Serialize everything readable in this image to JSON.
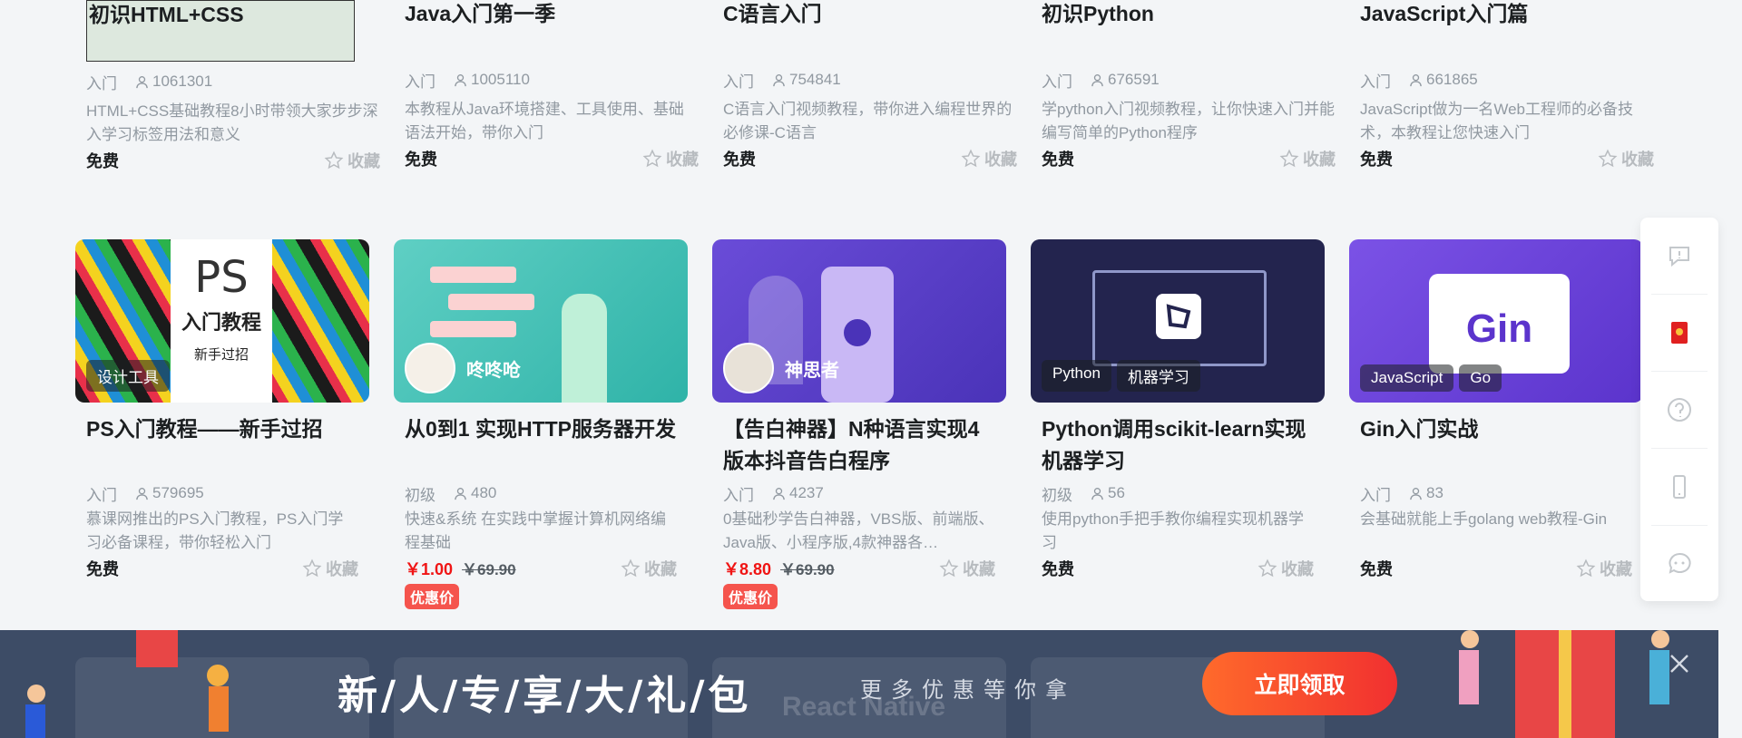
{
  "top_row": [
    {
      "title": "初识HTML+CSS",
      "level": "入门",
      "users": "1061301",
      "desc": "HTML+CSS基础教程8小时带领大家步步深入学习标签用法和意义",
      "price": "免费",
      "fav": "收藏"
    },
    {
      "title": "Java入门第一季",
      "level": "入门",
      "users": "1005110",
      "desc": "本教程从Java环境搭建、工具使用、基础语法开始，带你入门",
      "price": "免费",
      "fav": "收藏"
    },
    {
      "title": "C语言入门",
      "level": "入门",
      "users": "754841",
      "desc": "C语言入门视频教程，带你进入编程世界的必修课-C语言",
      "price": "免费",
      "fav": "收藏"
    },
    {
      "title": "初识Python",
      "level": "入门",
      "users": "676591",
      "desc": "学python入门视频教程，让你快速入门并能编写简单的Python程序",
      "price": "免费",
      "fav": "收藏"
    },
    {
      "title": "JavaScript入门篇",
      "level": "入门",
      "users": "661865",
      "desc": "JavaScript做为一名Web工程师的必备技术，本教程让您快速入门",
      "price": "免费",
      "fav": "收藏"
    }
  ],
  "cards": [
    {
      "title": "PS入门教程——新手过招",
      "tags": [
        "设计工具"
      ],
      "thumb_text": [
        "PS",
        "入门教程",
        "新手过招"
      ],
      "level": "入门",
      "users": "579695",
      "desc": "慕课网推出的PS入门教程，PS入门学习必备课程，带你轻松入门",
      "price": "免费",
      "fav": "收藏"
    },
    {
      "title": "从0到1 实现HTTP服务器开发",
      "author": "咚咚呛",
      "level": "初级",
      "users": "480",
      "desc": "快速&系统 在实践中掌握计算机网络编程基础",
      "price_now": "￥1.00",
      "price_old": "￥69.90",
      "sale": "优惠价",
      "fav": "收藏"
    },
    {
      "title": "【告白神器】N种语言实现4版本抖音告白程序",
      "author": "神思者",
      "level": "入门",
      "users": "4237",
      "desc": "0基础秒学告白神器，VBS版、前端版、Java版、小程序版,4款神器各…",
      "price_now": "￥8.80",
      "price_old": "￥69.90",
      "sale": "优惠价",
      "fav": "收藏"
    },
    {
      "title": "Python调用scikit-learn实现机器学习",
      "tags": [
        "Python",
        "机器学习"
      ],
      "level": "初级",
      "users": "56",
      "desc": "使用python手把手教你编程实现机器学习",
      "price": "免费",
      "fav": "收藏"
    },
    {
      "title": "Gin入门实战",
      "tags": [
        "JavaScript",
        "Go"
      ],
      "thumb_text": [
        "Gin"
      ],
      "level": "入门",
      "users": "83",
      "desc": "会基础就能上手golang web教程-Gin",
      "price": "免费",
      "fav": "收藏"
    }
  ],
  "sidebar": [
    "feedback-icon",
    "red-packet-icon",
    "help-icon",
    "mobile-icon",
    "chat-icon"
  ],
  "banner": {
    "main": "新/人/专/享/大/礼/包",
    "sub": "更多优惠等你拿",
    "button": "立即领取",
    "ghost_text": "React Native"
  },
  "colors": {
    "accent": "#f01414",
    "sale": "#f5544d",
    "banner": "#3d4c66"
  }
}
